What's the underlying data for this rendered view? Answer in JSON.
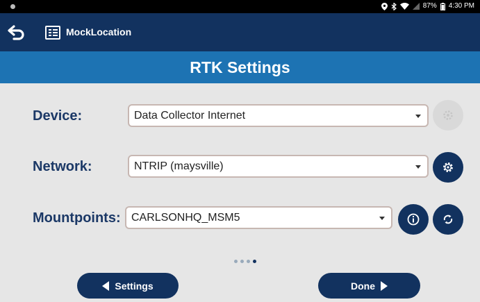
{
  "status_bar": {
    "icons": [
      "location-icon",
      "bluetooth-icon",
      "wifi-icon",
      "no-signal-icon",
      "battery-icon"
    ],
    "battery": "87%",
    "time": "4:30 PM"
  },
  "app_bar": {
    "title": "MockLocation"
  },
  "header": {
    "title": "RTK Settings"
  },
  "form": {
    "device": {
      "label": "Device:",
      "value": "Data Collector Internet"
    },
    "network": {
      "label": "Network:",
      "value": "NTRIP (maysville)"
    },
    "mountpoints": {
      "label": "Mountpoints:",
      "value": "CARLSONHQ_MSM5"
    }
  },
  "pager": {
    "pages": 4,
    "current": 4
  },
  "footer": {
    "settings_label": "Settings",
    "done_label": "Done"
  },
  "colors": {
    "navy": "#12325f",
    "blue_header": "#1d73b3",
    "background": "#e6e6e6",
    "label": "#1b3866"
  }
}
